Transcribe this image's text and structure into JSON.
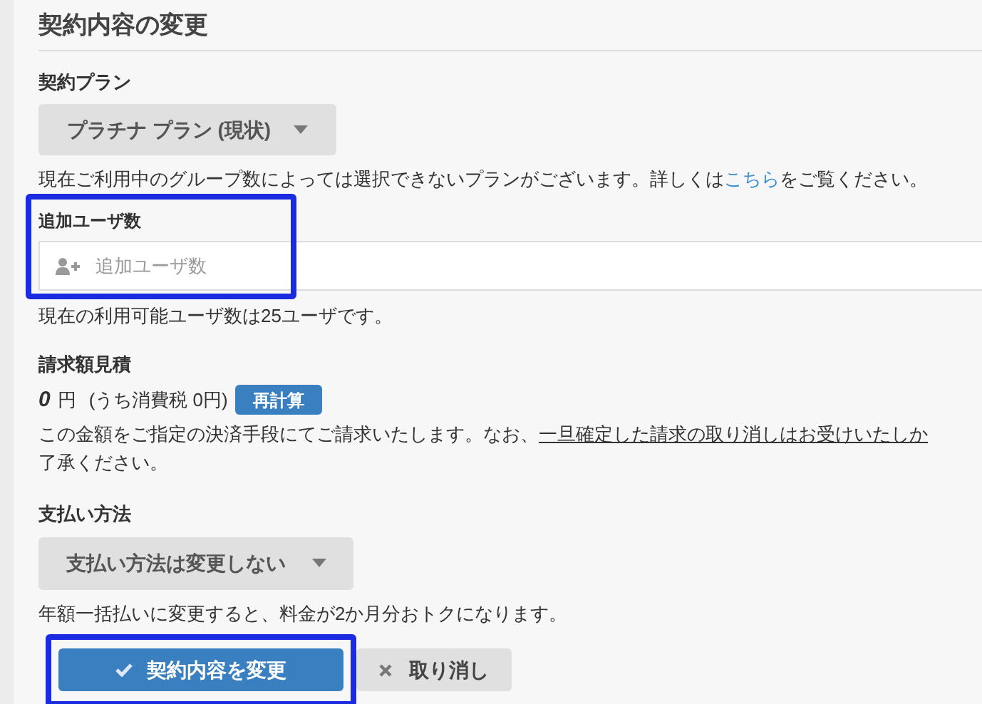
{
  "title": "契約内容の変更",
  "plan": {
    "label": "契約プラン",
    "value": "プラチナ プラン (現状)",
    "help_before": "現在ご利用中のグループ数によっては選択できないプランがございます。詳しくは",
    "help_link": "こちら",
    "help_after": "をご覧ください。"
  },
  "users": {
    "label": "追加ユーザ数",
    "placeholder": "追加ユーザ数",
    "highlighted": true,
    "note": "現在の利用可能ユーザ数は25ユーザです。"
  },
  "estimate": {
    "label": "請求額見積",
    "amount": "0",
    "unit": "円",
    "tax": "(うち消費税 0円)",
    "recalc_button": "再計算",
    "note_before": "この金額をご指定の決済手段にてご請求いたします。なお、",
    "note_link": "一旦確定した請求の取り消しはお受けいたしか",
    "note_line2": "了承ください。"
  },
  "payment": {
    "label": "支払い方法",
    "value": "支払い方法は変更しない",
    "note": "年額一括払いに変更すると、料金が2か月分おトクになります。"
  },
  "buttons": [
    {
      "kind": "primary",
      "label": "契約内容を変更",
      "highlighted": true
    },
    {
      "kind": "cancel",
      "label": "取り消し",
      "highlighted": false
    }
  ]
}
